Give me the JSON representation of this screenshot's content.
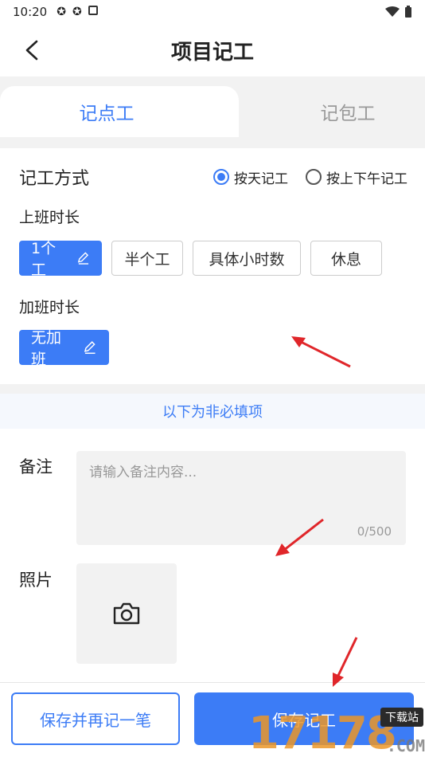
{
  "status_bar": {
    "time": "10:20"
  },
  "nav": {
    "title": "项目记工"
  },
  "tabs": [
    {
      "label": "记点工",
      "active": true
    },
    {
      "label": "记包工",
      "active": false
    }
  ],
  "method": {
    "title": "记工方式",
    "options": [
      {
        "label": "按天记工",
        "selected": true
      },
      {
        "label": "按上下午记工",
        "selected": false
      }
    ]
  },
  "work_hours": {
    "title": "上班时长",
    "options": [
      {
        "label": "1个工",
        "selected": true
      },
      {
        "label": "半个工",
        "selected": false
      },
      {
        "label": "具体小时数",
        "selected": false
      },
      {
        "label": "休息",
        "selected": false
      }
    ]
  },
  "overtime": {
    "title": "加班时长",
    "options": [
      {
        "label": "无加班",
        "selected": true
      }
    ]
  },
  "optional_hint": "以下为非必填项",
  "remark": {
    "label": "备注",
    "placeholder": "请输入备注内容...",
    "counter": "0/500"
  },
  "photo": {
    "label": "照片"
  },
  "buttons": {
    "save_again": "保存并再记一笔",
    "save": "保存记工"
  },
  "watermark": {
    "number": "17178",
    "badge": "下载站",
    "suffix": ".COM"
  },
  "colors": {
    "accent": "#3c7cf6",
    "annotation_arrow": "#e0262a"
  }
}
